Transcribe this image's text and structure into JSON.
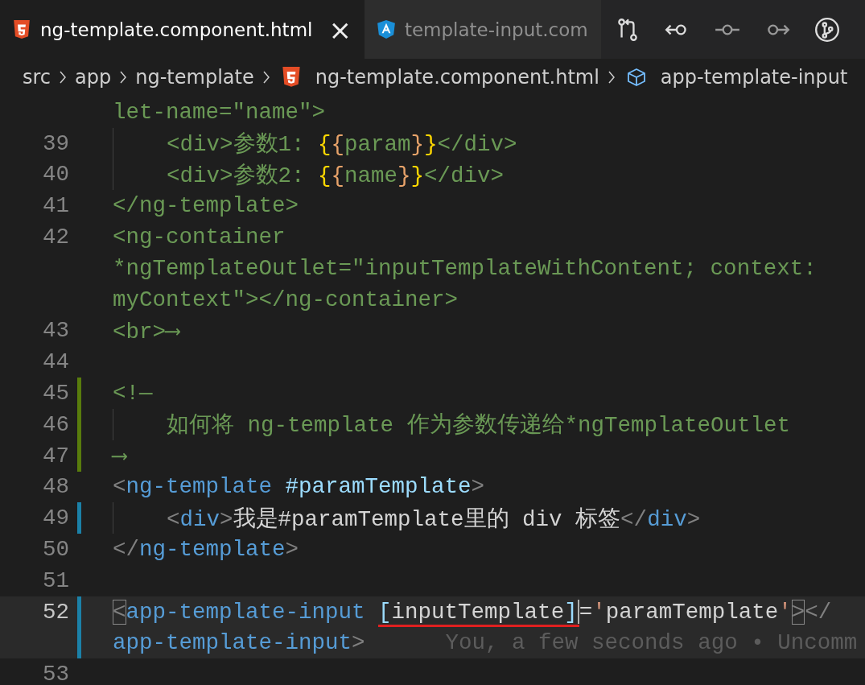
{
  "tabs": [
    {
      "label": "ng-template.component.html",
      "selected": true,
      "close": "×"
    },
    {
      "label": "template-input.com",
      "selected": false
    }
  ],
  "toolbar": [
    {
      "kind": "compare"
    },
    {
      "kind": "prev"
    },
    {
      "kind": "dot"
    },
    {
      "kind": "next"
    },
    {
      "kind": "branch"
    }
  ],
  "breadcrumb": [
    {
      "label": "src"
    },
    {
      "label": "app"
    },
    {
      "label": "ng-template"
    },
    {
      "label": "ng-template.component.html"
    },
    {
      "label": "app-template-input"
    }
  ],
  "lines": [
    {
      "indent": false,
      "current": false,
      "tokens": [
        {
          "text": "let-name=\"name\">",
          "kind": "comment"
        }
      ]
    },
    {
      "num": "39",
      "indent": true,
      "current": false,
      "tokens": [
        {
          "text": "<div>参数1: ",
          "kind": "comment"
        },
        {
          "text": "{",
          "kind": "bracket1"
        },
        {
          "text": "{",
          "kind": "bracket2"
        },
        {
          "text": "param",
          "kind": "comment"
        },
        {
          "text": "}",
          "kind": "bracket2"
        },
        {
          "text": "}",
          "kind": "bracket1"
        },
        {
          "text": "</div>",
          "kind": "comment"
        }
      ]
    },
    {
      "num": "40",
      "indent": true,
      "current": false,
      "tokens": [
        {
          "text": "<div>参数2: ",
          "kind": "comment"
        },
        {
          "text": "{",
          "kind": "bracket1"
        },
        {
          "text": "{",
          "kind": "bracket2"
        },
        {
          "text": "name",
          "kind": "comment"
        },
        {
          "text": "}",
          "kind": "bracket2"
        },
        {
          "text": "}",
          "kind": "bracket1"
        },
        {
          "text": "</div>",
          "kind": "comment"
        }
      ]
    },
    {
      "num": "41",
      "indent": false,
      "current": false,
      "tokens": [
        {
          "text": "</ng-template>",
          "kind": "comment"
        }
      ]
    },
    {
      "num": "42",
      "indent": false,
      "current": false,
      "tokens": [
        {
          "text": "<ng-container",
          "kind": "comment"
        }
      ]
    },
    {
      "indent": false,
      "current": false,
      "tokens": [
        {
          "text": "*ngTemplateOutlet=\"inputTemplateWithContent; context:",
          "kind": "comment"
        }
      ]
    },
    {
      "indent": false,
      "current": false,
      "tokens": [
        {
          "text": "myContext\"></ng-container>",
          "kind": "comment"
        }
      ]
    },
    {
      "num": "43",
      "indent": false,
      "current": false,
      "tokens": [
        {
          "text": "<br>⟶",
          "kind": "comment"
        }
      ]
    },
    {
      "num": "44",
      "indent": false,
      "current": false
    },
    {
      "num": "45",
      "color": "#587c0c",
      "indent": false,
      "current": false,
      "tokens": [
        {
          "text": "<!—",
          "kind": "comment"
        }
      ]
    },
    {
      "num": "46",
      "color": "#587c0c",
      "indent": true,
      "current": false,
      "tokens": [
        {
          "text": "如何将 ng-template 作为参数传递给*ngTemplateOutlet",
          "kind": "comment"
        }
      ]
    },
    {
      "num": "47",
      "color": "#587c0c",
      "indent": false,
      "current": false,
      "tokens": [
        {
          "text": "⟶",
          "kind": "comment"
        }
      ]
    },
    {
      "num": "48",
      "indent": false,
      "current": false,
      "tokens": [
        {
          "text": "<",
          "kind": "punct"
        },
        {
          "text": "ng-template",
          "kind": "tag"
        },
        {
          "text": " #paramTemplate",
          "kind": "attr"
        },
        {
          "text": ">",
          "kind": "punct"
        }
      ]
    },
    {
      "num": "49",
      "color": "#1b81a8",
      "indent": true,
      "current": false,
      "tokens": [
        {
          "text": "<",
          "kind": "punct"
        },
        {
          "text": "div",
          "kind": "tag"
        },
        {
          "text": ">",
          "kind": "punct"
        },
        {
          "text": "我是#paramTemplate里的 div 标签",
          "kind": "text"
        },
        {
          "text": "</",
          "kind": "punct"
        },
        {
          "text": "div",
          "kind": "tag"
        },
        {
          "text": ">",
          "kind": "punct"
        }
      ]
    },
    {
      "num": "50",
      "indent": false,
      "current": false,
      "tokens": [
        {
          "text": "</",
          "kind": "punct"
        },
        {
          "text": "ng-template",
          "kind": "tag"
        },
        {
          "text": ">",
          "kind": "punct"
        }
      ]
    },
    {
      "num": "51",
      "indent": false,
      "current": false
    },
    {
      "num": "52",
      "color": "#1b81a8",
      "indent": false,
      "current": true,
      "tokens": [
        {
          "text": "<",
          "kind": "punct",
          "boxed": true
        },
        {
          "text": "app-template-input ",
          "kind": "tag"
        },
        {
          "text": "[",
          "kind": "attr",
          "underlined": true
        },
        {
          "text": "inputTemplate",
          "kind": "text",
          "underlined": true
        },
        {
          "text": "]",
          "kind": "attr",
          "underlined": true,
          "cursor": true
        },
        {
          "text": "=",
          "kind": "text"
        },
        {
          "text": "'",
          "kind": "string"
        },
        {
          "text": "paramTemplate",
          "kind": "text"
        },
        {
          "text": "'",
          "kind": "string"
        },
        {
          "text": ">",
          "kind": "punct",
          "boxed": true
        },
        {
          "text": "</",
          "kind": "punct"
        }
      ]
    },
    {
      "color": "#1b81a8",
      "indent": false,
      "current": true,
      "tokens": [
        {
          "text": "app-template-input",
          "kind": "tag"
        },
        {
          "text": ">",
          "kind": "punct"
        }
      ],
      "blame": "You, a few seconds ago • Uncomm"
    },
    {
      "num": "53",
      "indent": false,
      "current": false
    }
  ]
}
